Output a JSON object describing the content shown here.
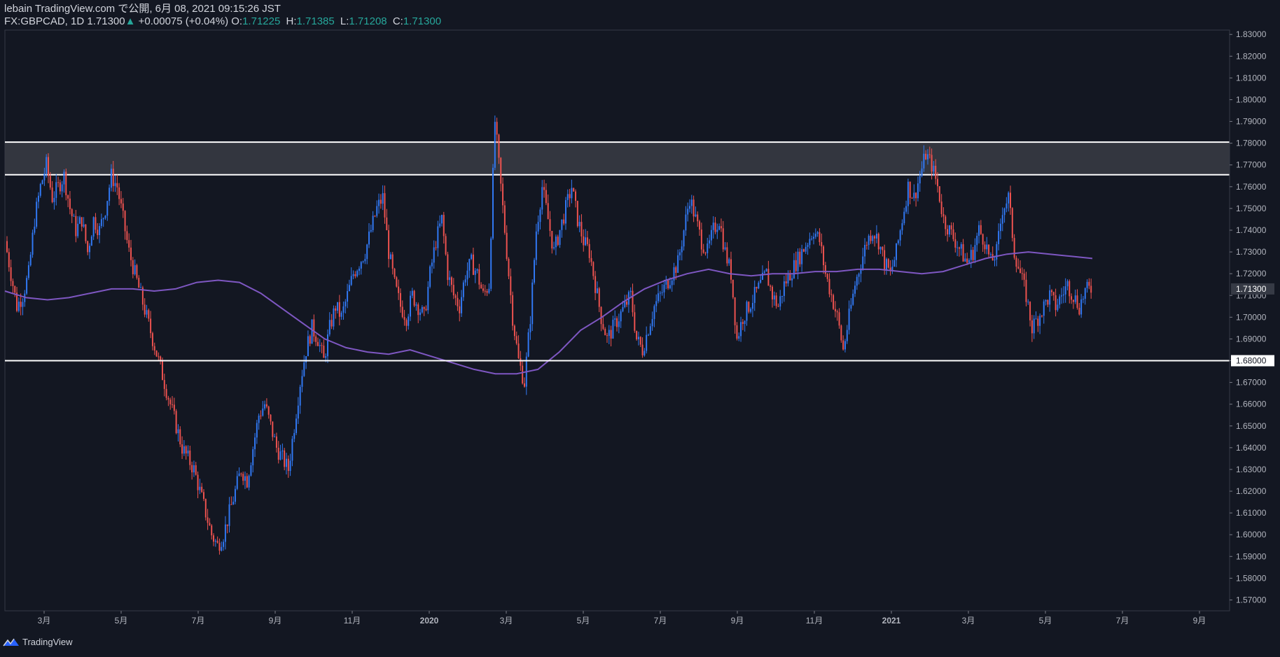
{
  "header": {
    "line1": "lebain TradingView.com で公開, 6月 08, 2021 09:15:26 JST",
    "symbol": "FX:GBPCAD, 1D",
    "last": "1.71300",
    "arrow": "▲",
    "change": "+0.00075 (+0.04%)",
    "o_label": "O:",
    "o_value": "1.71225",
    "h_label": "H:",
    "h_value": "1.71385",
    "l_label": "L:",
    "l_value": "1.71208",
    "c_label": "C:",
    "c_value": "1.71300"
  },
  "footer": {
    "brand": "TradingView"
  },
  "colors": {
    "background": "#131722",
    "up": "#3179f5",
    "down": "#ef5350",
    "ma": "#7e57c2",
    "zone_fill": "#3a3c44",
    "level_line": "#ffffff",
    "axis_text": "#b2b5be"
  },
  "chart_data": {
    "type": "candlestick",
    "symbol": "FX:GBPCAD",
    "timeframe": "1D",
    "ylim": [
      1.565,
      1.832
    ],
    "y_ticks": [
      "1.57000",
      "1.58000",
      "1.59000",
      "1.60000",
      "1.61000",
      "1.62000",
      "1.63000",
      "1.64000",
      "1.65000",
      "1.66000",
      "1.67000",
      "1.68000",
      "1.69000",
      "1.70000",
      "1.71000",
      "1.72000",
      "1.73000",
      "1.74000",
      "1.75000",
      "1.76000",
      "1.77000",
      "1.78000",
      "1.79000",
      "1.80000",
      "1.81000",
      "1.82000",
      "1.83000"
    ],
    "x_ticks": [
      "3月",
      "5月",
      "7月",
      "9月",
      "11月",
      "2020",
      "3月",
      "5月",
      "7月",
      "9月",
      "11月",
      "2021",
      "3月",
      "5月",
      "7月",
      "9月"
    ],
    "resistance_zone": [
      1.7655,
      1.7805
    ],
    "support_level": 1.68,
    "last_price_label": "1.71300",
    "support_label": "1.68000",
    "price_series": [
      1.735,
      1.72,
      1.705,
      1.71,
      1.72,
      1.745,
      1.76,
      1.77,
      1.755,
      1.76,
      1.765,
      1.75,
      1.74,
      1.745,
      1.73,
      1.745,
      1.74,
      1.75,
      1.765,
      1.76,
      1.745,
      1.73,
      1.72,
      1.71,
      1.7,
      1.69,
      1.68,
      1.67,
      1.66,
      1.65,
      1.64,
      1.635,
      1.63,
      1.62,
      1.61,
      1.6,
      1.595,
      1.6,
      1.61,
      1.62,
      1.63,
      1.625,
      1.64,
      1.655,
      1.66,
      1.65,
      1.64,
      1.635,
      1.63,
      1.65,
      1.67,
      1.685,
      1.695,
      1.69,
      1.68,
      1.695,
      1.705,
      1.7,
      1.71,
      1.72,
      1.725,
      1.73,
      1.74,
      1.75,
      1.755,
      1.73,
      1.715,
      1.705,
      1.7,
      1.71,
      1.705,
      1.7,
      1.72,
      1.735,
      1.745,
      1.72,
      1.71,
      1.705,
      1.72,
      1.725,
      1.72,
      1.71,
      1.715,
      1.79,
      1.76,
      1.73,
      1.7,
      1.68,
      1.67,
      1.7,
      1.74,
      1.76,
      1.745,
      1.73,
      1.74,
      1.75,
      1.76,
      1.745,
      1.735,
      1.73,
      1.715,
      1.7,
      1.69,
      1.695,
      1.7,
      1.705,
      1.71,
      1.69,
      1.685,
      1.695,
      1.705,
      1.71,
      1.715,
      1.72,
      1.725,
      1.74,
      1.755,
      1.745,
      1.735,
      1.73,
      1.74,
      1.745,
      1.73,
      1.72,
      1.69,
      1.7,
      1.705,
      1.71,
      1.715,
      1.72,
      1.71,
      1.705,
      1.715,
      1.72,
      1.725,
      1.73,
      1.735,
      1.74,
      1.735,
      1.72,
      1.71,
      1.7,
      1.685,
      1.7,
      1.715,
      1.725,
      1.735,
      1.74,
      1.735,
      1.725,
      1.72,
      1.73,
      1.745,
      1.76,
      1.755,
      1.765,
      1.775,
      1.77,
      1.76,
      1.745,
      1.74,
      1.735,
      1.73,
      1.725,
      1.73,
      1.74,
      1.735,
      1.725,
      1.73,
      1.75,
      1.755,
      1.73,
      1.72,
      1.71,
      1.695,
      1.7,
      1.705,
      1.71,
      1.705,
      1.71,
      1.715,
      1.71,
      1.705,
      1.712,
      1.713
    ],
    "ma_series": [
      1.712,
      1.709,
      1.708,
      1.709,
      1.711,
      1.713,
      1.713,
      1.712,
      1.713,
      1.716,
      1.717,
      1.716,
      1.711,
      1.704,
      1.697,
      1.69,
      1.686,
      1.684,
      1.683,
      1.685,
      1.682,
      1.679,
      1.676,
      1.674,
      1.674,
      1.676,
      1.684,
      1.694,
      1.7,
      1.707,
      1.713,
      1.717,
      1.72,
      1.722,
      1.72,
      1.719,
      1.72,
      1.72,
      1.721,
      1.721,
      1.722,
      1.722,
      1.721,
      1.72,
      1.721,
      1.724,
      1.727,
      1.729,
      1.73,
      1.729,
      1.728,
      1.727
    ]
  }
}
